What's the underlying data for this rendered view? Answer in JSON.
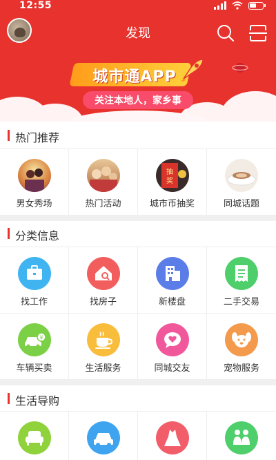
{
  "status": {
    "time": "12:55"
  },
  "header": {
    "title": "发现"
  },
  "banner": {
    "headline": "城市通APP",
    "slogan": "关注本地人，家乡事"
  },
  "sections": {
    "hot": {
      "title": "热门推荐",
      "items": [
        {
          "label": "男女秀场",
          "icon": "couple-photo"
        },
        {
          "label": "热门活动",
          "icon": "crowd-photo"
        },
        {
          "label": "城市币抽奖",
          "icon": "lottery-photo"
        },
        {
          "label": "同城话题",
          "icon": "coffee-photo"
        }
      ]
    },
    "category": {
      "title": "分类信息",
      "items": [
        {
          "label": "找工作",
          "icon": "briefcase-icon",
          "color": "#3fb4f0"
        },
        {
          "label": "找房子",
          "icon": "house-search-icon",
          "color": "#f25d5d"
        },
        {
          "label": "新楼盘",
          "icon": "building-icon",
          "color": "#5b7de8"
        },
        {
          "label": "二手交易",
          "icon": "receipt-icon",
          "color": "#4fcf6b"
        },
        {
          "label": "车辆买卖",
          "icon": "car-yen-icon",
          "color": "#7bd046"
        },
        {
          "label": "生活服务",
          "icon": "coffee-cup-icon",
          "color": "#f9bd3c"
        },
        {
          "label": "同城交友",
          "icon": "heart-chat-icon",
          "color": "#f0589b"
        },
        {
          "label": "宠物服务",
          "icon": "dog-icon",
          "color": "#f49a4d"
        }
      ]
    },
    "life": {
      "title": "生活导购",
      "items": [
        {
          "label": "",
          "icon": "sofa-icon",
          "color": "#8fd23c"
        },
        {
          "label": "",
          "icon": "car-icon",
          "color": "#3fa4f0"
        },
        {
          "label": "",
          "icon": "dress-icon",
          "color": "#f25d6a"
        },
        {
          "label": "",
          "icon": "family-icon",
          "color": "#4fcf6b"
        }
      ]
    }
  }
}
